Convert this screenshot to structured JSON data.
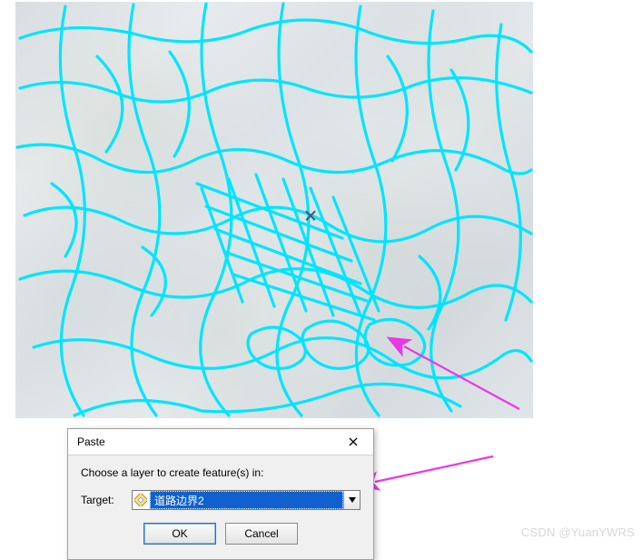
{
  "dialog": {
    "title": "Paste",
    "prompt": "Choose a layer to create feature(s) in:",
    "target_label": "Target:",
    "target_value": "道路边界2",
    "ok_label": "OK",
    "cancel_label": "Cancel"
  },
  "colors": {
    "road_stroke": "#00e5ff",
    "arrow": "#e838e8",
    "selection_bg": "#1060d0"
  },
  "watermark": "CSDN @YuanYWRS"
}
